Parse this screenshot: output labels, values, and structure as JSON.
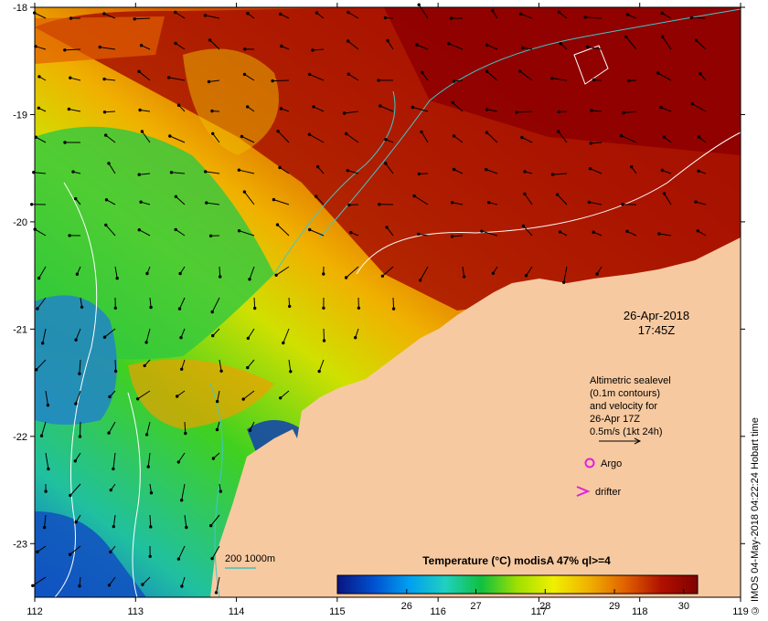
{
  "map": {
    "x_ticks": [
      "112",
      "113",
      "114",
      "115",
      "116",
      "117",
      "118",
      "119"
    ],
    "y_ticks": [
      "-18",
      "-19",
      "-20",
      "-21",
      "-22",
      "-23"
    ],
    "x_range": [
      112,
      119
    ],
    "y_range": [
      -23.5,
      -18
    ]
  },
  "timestamp": {
    "date": "26-Apr-2018",
    "time": "17:45Z"
  },
  "velocity_note": {
    "lines": [
      "Altimetric sealevel",
      "(0.1m contours)",
      "and velocity for",
      "26-Apr 17Z",
      "0.5m/s (1kt 24h)"
    ]
  },
  "legend": {
    "argo_label": "Argo",
    "drifter_label": "drifter",
    "argo_color": "#e020e0",
    "drifter_color": "#e020e0"
  },
  "depth_scale": {
    "label": "200  1000m",
    "color": "#40c0c0"
  },
  "colorbar": {
    "title": "Temperature (°C) modisA 47% ql>=4",
    "ticks": [
      "26",
      "27",
      "28",
      "29",
      "30"
    ],
    "range": [
      25.0,
      30.2
    ],
    "colors": [
      "#0a1480",
      "#0050d0",
      "#00a0f0",
      "#20d0c0",
      "#10c040",
      "#a0e000",
      "#f0f000",
      "#f0b000",
      "#e06000",
      "#b01000",
      "#800000"
    ]
  },
  "credit": "© IMOS 04-May-2018 04:22:24 Hobart time",
  "land_color": "#f7c9a0"
}
